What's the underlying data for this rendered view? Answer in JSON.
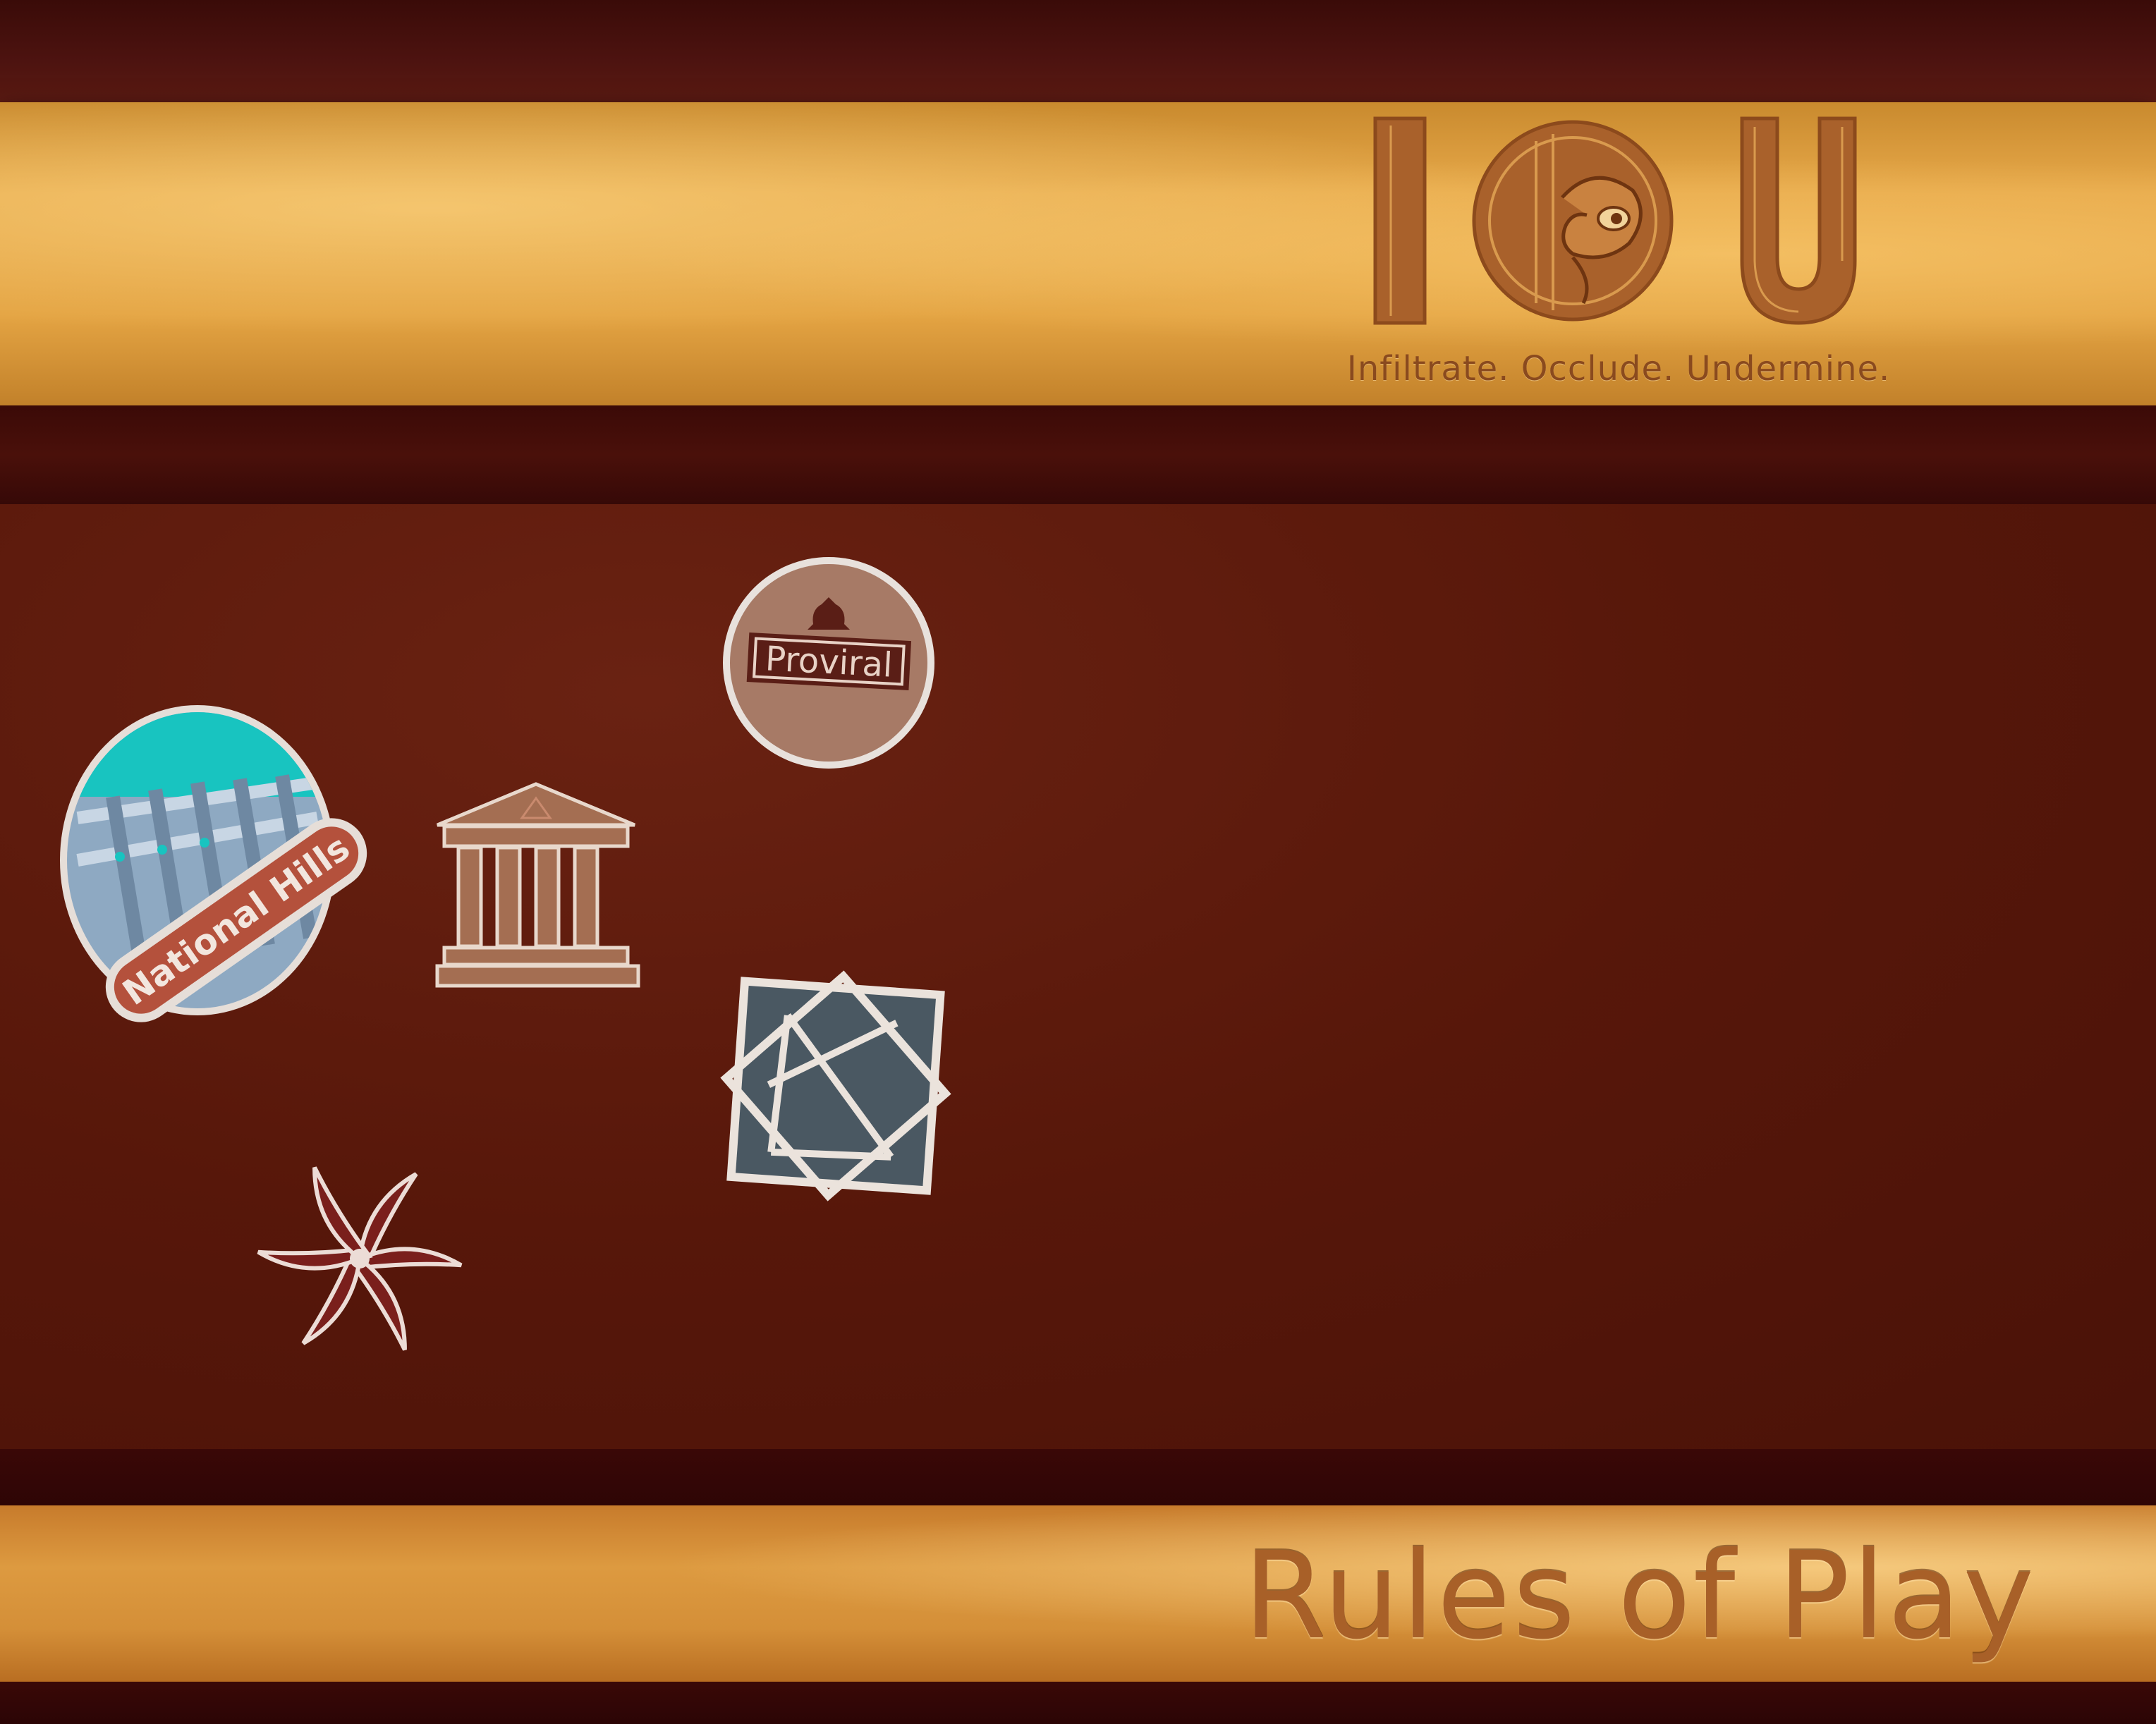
{
  "logo": {
    "text": "IOU",
    "tagline": "Infiltrate. Occlude. Undermine."
  },
  "cover": {
    "title": "Rules of Play"
  },
  "tokens": {
    "proviral": {
      "label": "Proviral"
    },
    "national_hills": {
      "label": "National Hills"
    },
    "bank": {
      "icon": "bank-building-icon"
    },
    "geometric": {
      "icon": "geometric-star-icon"
    },
    "swirl": {
      "icon": "swirl-icon"
    }
  },
  "colors": {
    "gold": "#e4a443",
    "dark_maroon": "#3a0b08",
    "brown_field": "#57170a",
    "logo_brown": "#a0592a",
    "token_slate": "#4a5862",
    "token_red": "#7a1f1c",
    "token_tan": "#a77a66"
  }
}
